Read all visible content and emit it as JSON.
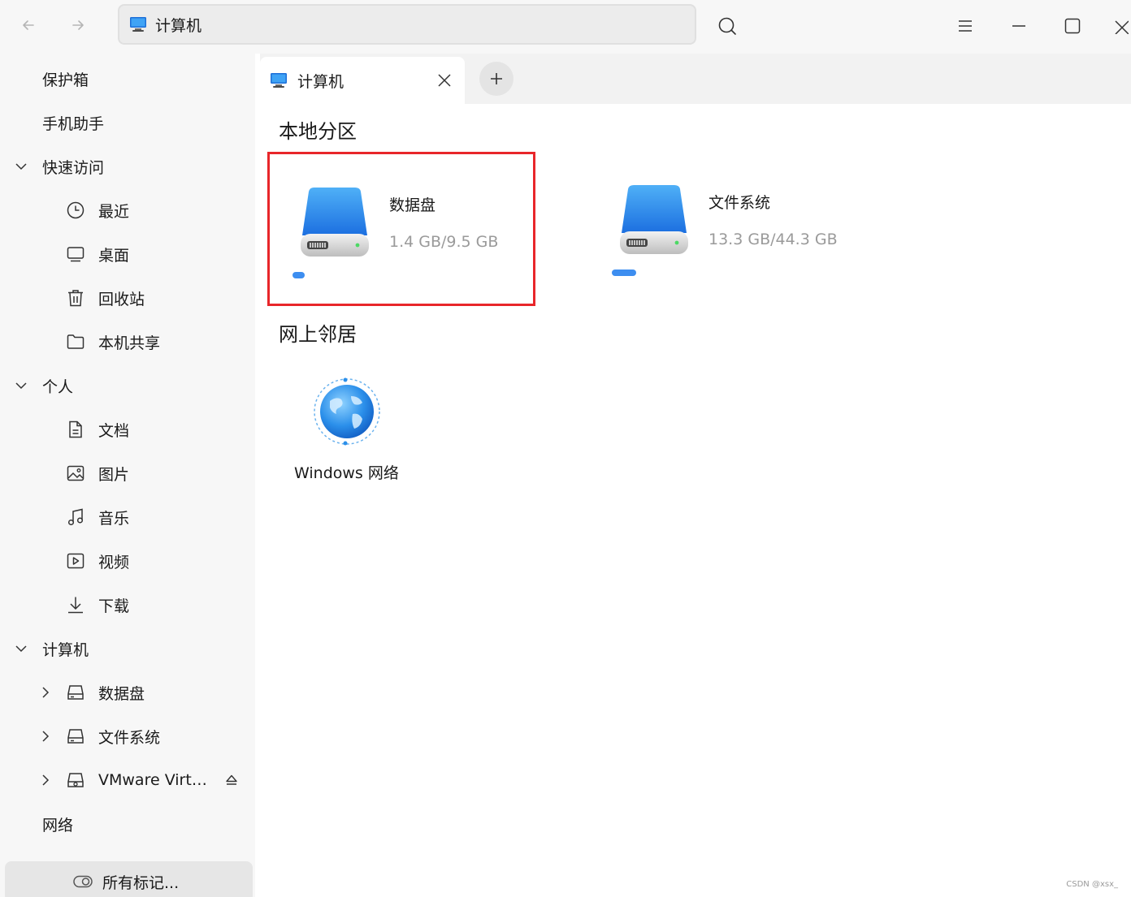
{
  "toolbar": {
    "address": "计算机"
  },
  "sidebar": {
    "top_items": [
      {
        "label": "保护箱"
      },
      {
        "label": "手机助手"
      }
    ],
    "quick_access": {
      "label": "快速访问",
      "items": [
        {
          "label": "最近",
          "icon": "clock-icon"
        },
        {
          "label": "桌面",
          "icon": "desktop-icon"
        },
        {
          "label": "回收站",
          "icon": "trash-icon"
        },
        {
          "label": "本机共享",
          "icon": "folder-icon"
        }
      ]
    },
    "personal": {
      "label": "个人",
      "items": [
        {
          "label": "文档",
          "icon": "document-icon"
        },
        {
          "label": "图片",
          "icon": "image-icon"
        },
        {
          "label": "音乐",
          "icon": "music-icon"
        },
        {
          "label": "视频",
          "icon": "video-icon"
        },
        {
          "label": "下载",
          "icon": "download-icon"
        }
      ]
    },
    "computer": {
      "label": "计算机",
      "items": [
        {
          "label": "数据盘",
          "icon": "drive-icon"
        },
        {
          "label": "文件系统",
          "icon": "drive-icon"
        },
        {
          "label": "VMware Virt…",
          "icon": "optical-drive-icon"
        }
      ]
    },
    "network": {
      "label": "网络"
    },
    "tags": {
      "label": "所有标记..."
    }
  },
  "tabs": [
    {
      "label": "计算机"
    }
  ],
  "main": {
    "local_section": "本地分区",
    "drives": [
      {
        "name": "数据盘",
        "size": "1.4 GB/9.5 GB",
        "usage": 0.147,
        "selected": true
      },
      {
        "name": "文件系统",
        "size": "13.3 GB/44.3 GB",
        "usage": 0.3,
        "selected": false
      }
    ],
    "network_section": "网上邻居",
    "network_items": [
      {
        "label": "Windows 网络"
      }
    ]
  },
  "watermark": "CSDN @xsx_",
  "colors": {
    "accent": "#3d8ef0",
    "selection_border": "#e8262a",
    "sidebar_bg": "#f7f7f7"
  }
}
